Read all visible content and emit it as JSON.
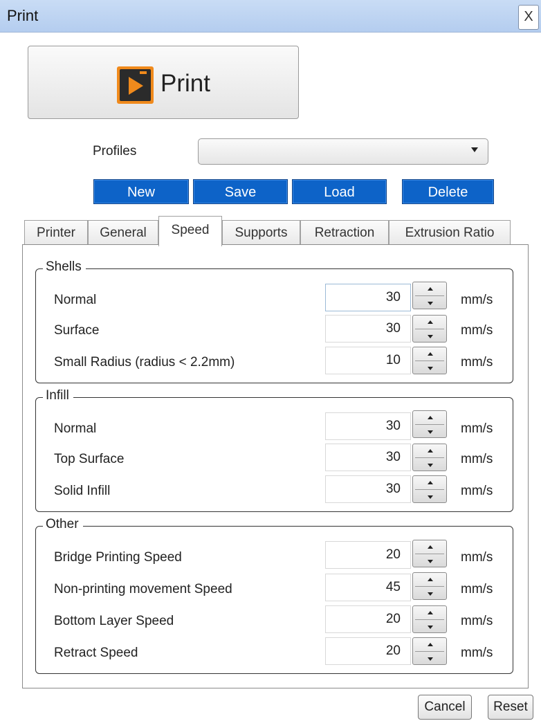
{
  "window": {
    "title": "Print",
    "close_label": "X"
  },
  "print_button": {
    "label": "Print",
    "icon": "print-play-icon"
  },
  "profiles": {
    "label": "Profiles",
    "selected": ""
  },
  "actions": {
    "new": "New",
    "save": "Save",
    "load": "Load",
    "delete": "Delete"
  },
  "tabs": [
    {
      "label": "Printer"
    },
    {
      "label": "General"
    },
    {
      "label": "Speed",
      "active": true
    },
    {
      "label": "Supports"
    },
    {
      "label": "Retraction"
    },
    {
      "label": "Extrusion Ratio"
    }
  ],
  "groups": {
    "shells": {
      "title": "Shells",
      "rows": [
        {
          "label": "Normal",
          "value": "30",
          "unit": "mm/s"
        },
        {
          "label": "Surface",
          "value": "30",
          "unit": "mm/s"
        },
        {
          "label": "Small Radius (radius < 2.2mm)",
          "value": "10",
          "unit": "mm/s"
        }
      ]
    },
    "infill": {
      "title": "Infill",
      "rows": [
        {
          "label": "Normal",
          "value": "30",
          "unit": "mm/s"
        },
        {
          "label": "Top Surface",
          "value": "30",
          "unit": "mm/s"
        },
        {
          "label": "Solid Infill",
          "value": "30",
          "unit": "mm/s"
        }
      ]
    },
    "other": {
      "title": "Other",
      "rows": [
        {
          "label": "Bridge Printing Speed",
          "value": "20",
          "unit": "mm/s"
        },
        {
          "label": "Non-printing movement Speed",
          "value": "45",
          "unit": "mm/s"
        },
        {
          "label": "Bottom Layer Speed",
          "value": "20",
          "unit": "mm/s"
        },
        {
          "label": "Retract Speed",
          "value": "20",
          "unit": "mm/s"
        }
      ]
    }
  },
  "footer": {
    "cancel": "Cancel",
    "reset": "Reset"
  },
  "colors": {
    "titlebar": "#b4cdef",
    "action_blue": "#0d63c8",
    "icon_orange": "#f08a1c"
  }
}
